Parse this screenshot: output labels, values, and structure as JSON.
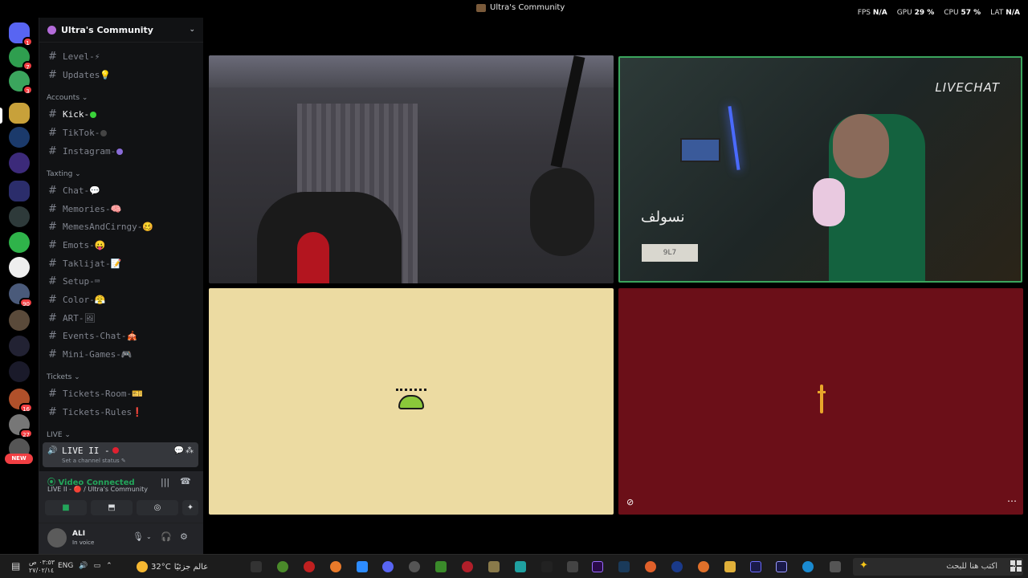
{
  "titlebar": {
    "title": "Ultra's Community"
  },
  "perf": {
    "fps_label": "FPS",
    "fps": "N/A",
    "gpu_label": "GPU",
    "gpu": "29 %",
    "cpu_label": "CPU",
    "cpu": "57 %",
    "lat_label": "LAT",
    "lat": "N/A"
  },
  "servers": {
    "badges": [
      "1",
      "7",
      "3",
      "90",
      "16",
      "27"
    ],
    "new_tag": "NEW"
  },
  "guild": {
    "name": "Ultra's Community"
  },
  "channels": {
    "level": "Level-⚡",
    "updates": "Updates💡",
    "cat_accounts": "Accounts ⌄",
    "kick": "Kick-",
    "tiktok": "TikTok-",
    "instagram": "Instagram-",
    "cat_texting": "Taxting ⌄",
    "chat": "Chat-💬",
    "memories": "Memories-🧠",
    "memes": "MemesAndCirngy-🥴",
    "emots": "Emots-😛",
    "taklijat": "Taklijat-📝",
    "setup": "Setup-⌨",
    "color": "Color-😤",
    "art": "ART-🖼",
    "events": "Events-Chat-🎪",
    "minigames": "Mini-Games-🎮",
    "cat_tickets": "Tickets ⌄",
    "tickets_room": "Tickets-Room-🎫",
    "tickets_rules": "Tickets-Rules❗",
    "cat_live": "LIVE ⌄"
  },
  "voice_channel": {
    "name": "LIVE II -",
    "status": "Set a channel status ✎"
  },
  "voice_panel": {
    "connected": "Video Connected",
    "sub": "LIVE II - 🔴 / Ultra's Community"
  },
  "user": {
    "name": "ALI",
    "status": "In voice"
  },
  "stage": {
    "livechat": "LIVECHAT",
    "overlay_name": "نسولف",
    "overlay_tag": "9L7"
  },
  "taskbar": {
    "clock_time": "٠٣:٥٣ ص",
    "clock_date": "٢٧/٠٢/١٤",
    "lang": "ENG",
    "temp": "32°C",
    "weather_text": "عالم جزئيًا",
    "search_placeholder": "اكتب هنا للبحث"
  },
  "colors": {
    "green": "#23a55a",
    "red": "#f23f43",
    "tile_cream": "#ecdba2",
    "tile_maroon": "#6b0f18"
  }
}
